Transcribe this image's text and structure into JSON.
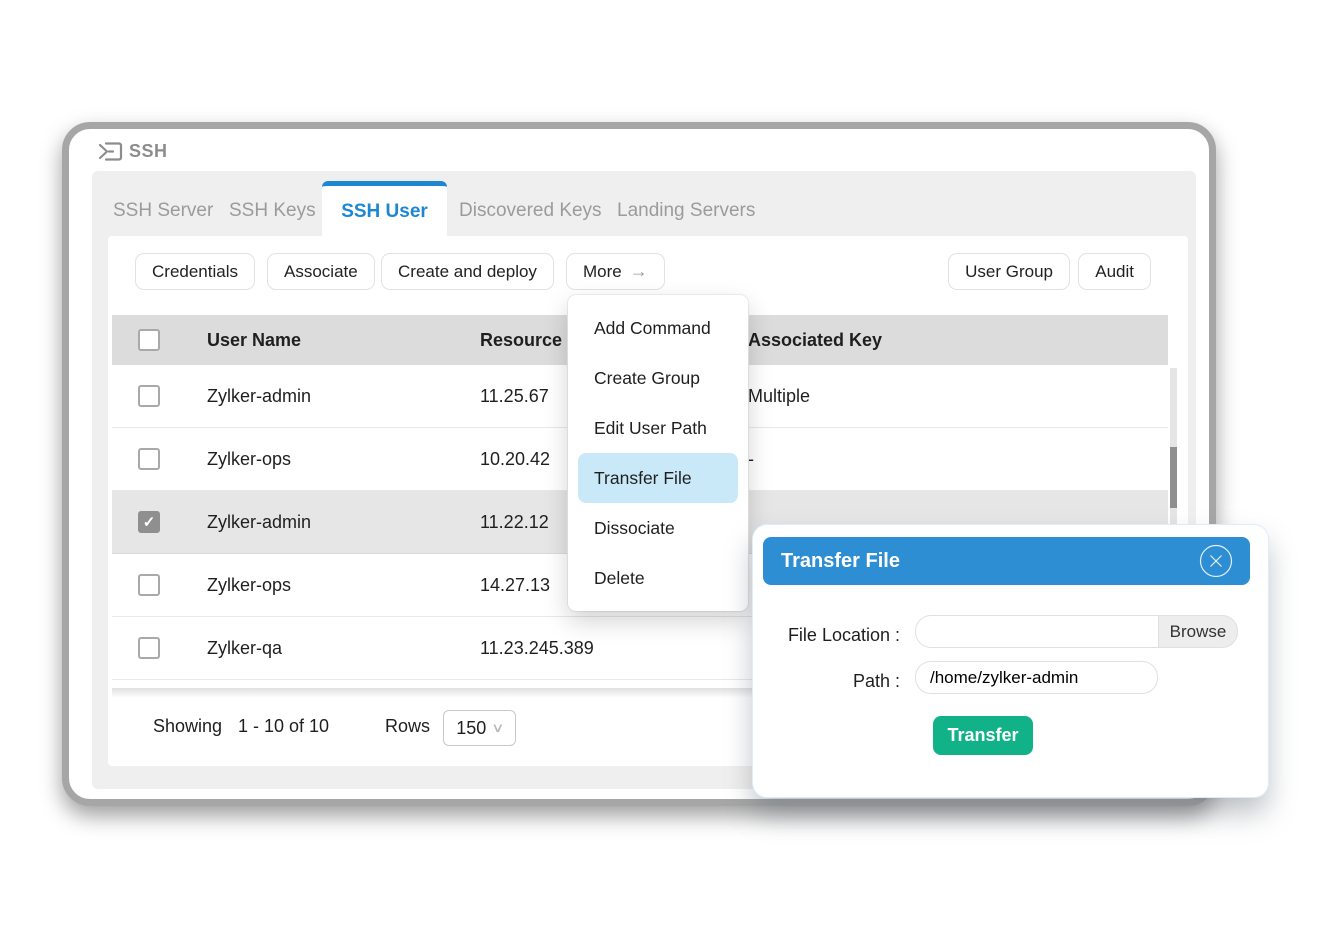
{
  "window": {
    "title": "SSH"
  },
  "icons": {
    "app": "terminal-prompt-icon",
    "more_arrow": "→",
    "rows_chevron": "∨",
    "close": "circle-x-icon",
    "check": "✓"
  },
  "colors": {
    "accent_blue": "#1d87d2",
    "modal_header_blue": "#2e8ed3",
    "menu_highlight_blue": "#c9e9f9",
    "transfer_green": "#12b288",
    "header_gray": "#dcdcdc",
    "selected_row_gray": "#e6e6e6",
    "panel_gray": "#f0efef"
  },
  "tabs": [
    {
      "label": "SSH Server",
      "active": false
    },
    {
      "label": "SSH Keys",
      "active": false
    },
    {
      "label": "SSH User",
      "active": true
    },
    {
      "label": "Discovered Keys",
      "active": false
    },
    {
      "label": "Landing Servers",
      "active": false
    }
  ],
  "toolbar": {
    "credentials": "Credentials",
    "associate": "Associate",
    "create_and_deploy": "Create and deploy",
    "more": "More",
    "user_group": "User Group",
    "audit": "Audit"
  },
  "table": {
    "headers": {
      "user_name": "User Name",
      "resource": "Resource",
      "associated_key": "Associated Key"
    },
    "rows": [
      {
        "checked": false,
        "user": "Zylker-admin",
        "resource": "11.25.67",
        "key": "Multiple"
      },
      {
        "checked": false,
        "user": "Zylker-ops",
        "resource": "10.20.42",
        "key": "-"
      },
      {
        "checked": true,
        "user": "Zylker-admin",
        "resource": "11.22.12",
        "key": ""
      },
      {
        "checked": false,
        "user": "Zylker-ops",
        "resource": "14.27.13",
        "key": ""
      },
      {
        "checked": false,
        "user": "Zylker-qa",
        "resource": "11.23.245.389",
        "key": ""
      }
    ]
  },
  "menu": {
    "items": [
      {
        "label": "Add Command",
        "highlighted": false
      },
      {
        "label": "Create Group",
        "highlighted": false
      },
      {
        "label": "Edit User Path",
        "highlighted": false
      },
      {
        "label": "Transfer File",
        "highlighted": true
      },
      {
        "label": "Dissociate",
        "highlighted": false
      },
      {
        "label": "Delete",
        "highlighted": false
      }
    ]
  },
  "modal": {
    "title": "Transfer File",
    "file_location_label": "File Location :",
    "file_location_value": "",
    "browse_label": "Browse",
    "path_label": "Path :",
    "path_value": "/home/zylker-admin",
    "submit_label": "Transfer"
  },
  "footer": {
    "showing_label": "Showing",
    "range": "1 - 10 of  10",
    "rows_label": "Rows",
    "rows_value": "150"
  }
}
